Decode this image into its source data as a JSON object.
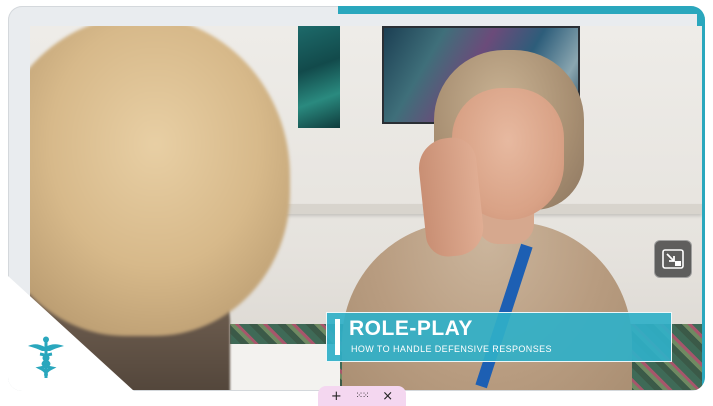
{
  "caption": {
    "title": "ROLE-PLAY",
    "subtitle": "HOW TO HANDLE DEFENSIVE RESPONSES"
  },
  "icons": {
    "logo": "medical-caduceus-icon",
    "pip": "exit-picture-in-picture-icon",
    "toolbar_add": "plus-icon",
    "toolbar_drag": "drag-handle-icon",
    "toolbar_close": "close-icon"
  },
  "toolbar": {
    "add_label": "+",
    "drag_label": "⁙⁙",
    "close_label": "×"
  },
  "colors": {
    "accent": "#2aa7bd",
    "caption_bg": "#30b0c8",
    "toolbar_bg": "#f4d7f0",
    "logo": "#2aa7bd"
  }
}
